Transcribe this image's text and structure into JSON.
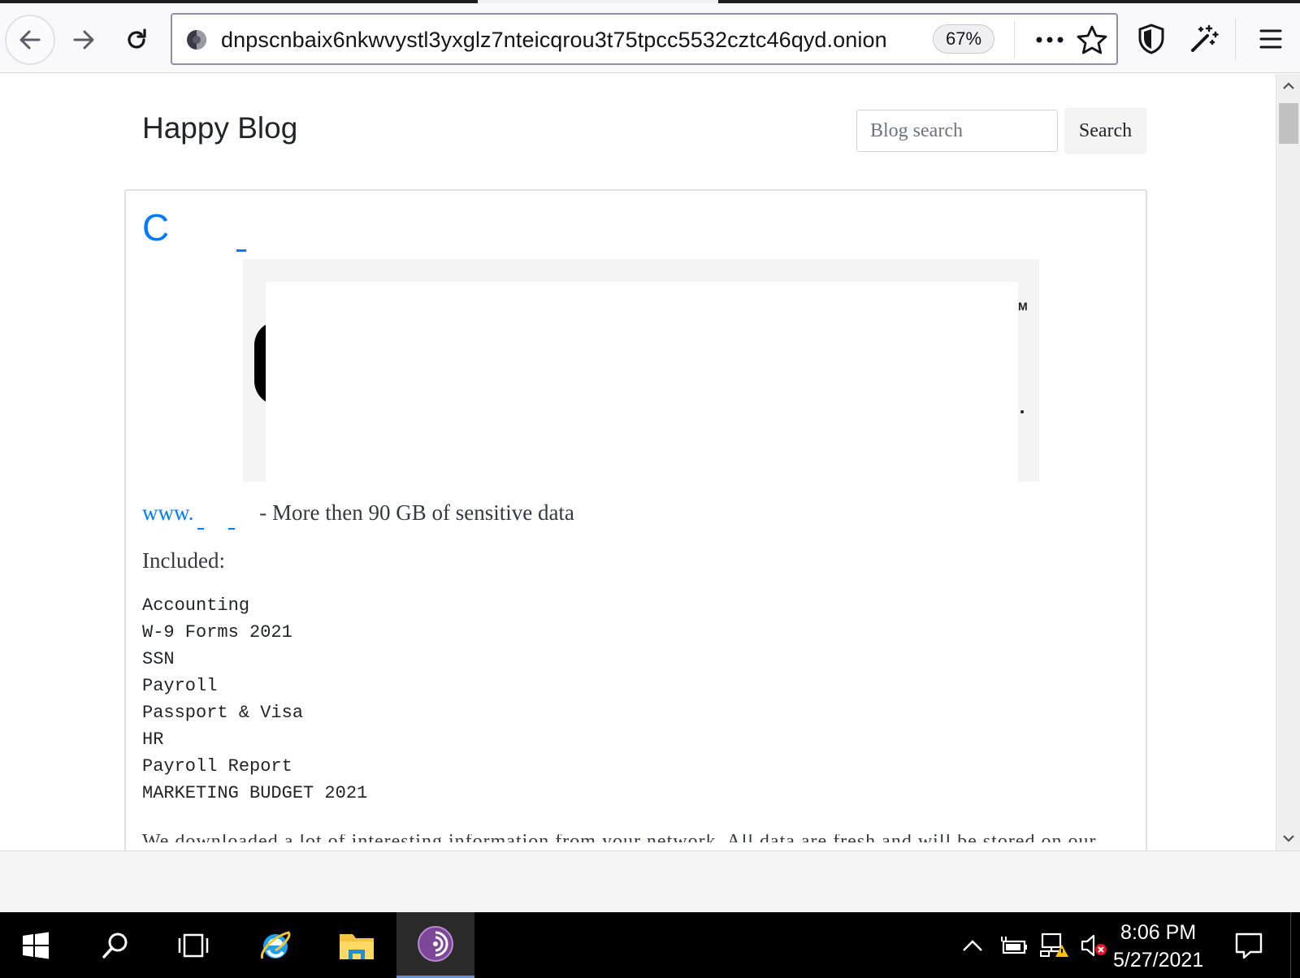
{
  "browser": {
    "url": "dnpscnbaix6nkwvystl3yxglz7nteicqrou3t75tpcc5532cztc46qyd.onion",
    "zoom": "67%"
  },
  "page": {
    "blog_title": "Happy Blog",
    "search_placeholder": "Blog search",
    "search_button": "Search",
    "post": {
      "title_link_fragment": "C",
      "www_fragment": "www.",
      "data_line": " - More then 90 GB of sensitive data",
      "included_label": "Included:",
      "files": [
        "Accounting",
        "W-9 Forms 2021",
        "SSN",
        "Payroll",
        "Passport & Visa",
        "HR",
        "Payroll Report",
        "MARKETING BUDGET 2021"
      ],
      "cut_off_text": "We downloaded a lot of interesting information from your network. All data are fresh and will be stored on our"
    }
  },
  "taskbar": {
    "time": "8:06 PM",
    "date": "5/27/2021"
  }
}
